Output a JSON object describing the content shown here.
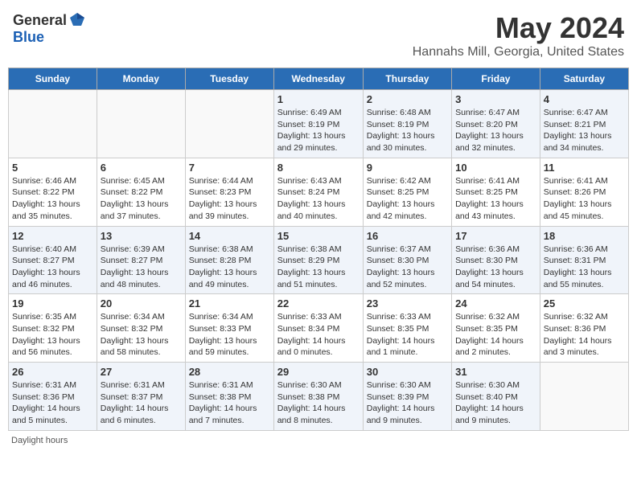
{
  "header": {
    "logo_general": "General",
    "logo_blue": "Blue",
    "month_title": "May 2024",
    "location": "Hannahs Mill, Georgia, United States"
  },
  "days_of_week": [
    "Sunday",
    "Monday",
    "Tuesday",
    "Wednesday",
    "Thursday",
    "Friday",
    "Saturday"
  ],
  "weeks": [
    [
      {
        "day": "",
        "content": ""
      },
      {
        "day": "",
        "content": ""
      },
      {
        "day": "",
        "content": ""
      },
      {
        "day": "1",
        "content": "Sunrise: 6:49 AM\nSunset: 8:19 PM\nDaylight: 13 hours and 29 minutes."
      },
      {
        "day": "2",
        "content": "Sunrise: 6:48 AM\nSunset: 8:19 PM\nDaylight: 13 hours and 30 minutes."
      },
      {
        "day": "3",
        "content": "Sunrise: 6:47 AM\nSunset: 8:20 PM\nDaylight: 13 hours and 32 minutes."
      },
      {
        "day": "4",
        "content": "Sunrise: 6:47 AM\nSunset: 8:21 PM\nDaylight: 13 hours and 34 minutes."
      }
    ],
    [
      {
        "day": "5",
        "content": "Sunrise: 6:46 AM\nSunset: 8:22 PM\nDaylight: 13 hours and 35 minutes."
      },
      {
        "day": "6",
        "content": "Sunrise: 6:45 AM\nSunset: 8:22 PM\nDaylight: 13 hours and 37 minutes."
      },
      {
        "day": "7",
        "content": "Sunrise: 6:44 AM\nSunset: 8:23 PM\nDaylight: 13 hours and 39 minutes."
      },
      {
        "day": "8",
        "content": "Sunrise: 6:43 AM\nSunset: 8:24 PM\nDaylight: 13 hours and 40 minutes."
      },
      {
        "day": "9",
        "content": "Sunrise: 6:42 AM\nSunset: 8:25 PM\nDaylight: 13 hours and 42 minutes."
      },
      {
        "day": "10",
        "content": "Sunrise: 6:41 AM\nSunset: 8:25 PM\nDaylight: 13 hours and 43 minutes."
      },
      {
        "day": "11",
        "content": "Sunrise: 6:41 AM\nSunset: 8:26 PM\nDaylight: 13 hours and 45 minutes."
      }
    ],
    [
      {
        "day": "12",
        "content": "Sunrise: 6:40 AM\nSunset: 8:27 PM\nDaylight: 13 hours and 46 minutes."
      },
      {
        "day": "13",
        "content": "Sunrise: 6:39 AM\nSunset: 8:27 PM\nDaylight: 13 hours and 48 minutes."
      },
      {
        "day": "14",
        "content": "Sunrise: 6:38 AM\nSunset: 8:28 PM\nDaylight: 13 hours and 49 minutes."
      },
      {
        "day": "15",
        "content": "Sunrise: 6:38 AM\nSunset: 8:29 PM\nDaylight: 13 hours and 51 minutes."
      },
      {
        "day": "16",
        "content": "Sunrise: 6:37 AM\nSunset: 8:30 PM\nDaylight: 13 hours and 52 minutes."
      },
      {
        "day": "17",
        "content": "Sunrise: 6:36 AM\nSunset: 8:30 PM\nDaylight: 13 hours and 54 minutes."
      },
      {
        "day": "18",
        "content": "Sunrise: 6:36 AM\nSunset: 8:31 PM\nDaylight: 13 hours and 55 minutes."
      }
    ],
    [
      {
        "day": "19",
        "content": "Sunrise: 6:35 AM\nSunset: 8:32 PM\nDaylight: 13 hours and 56 minutes."
      },
      {
        "day": "20",
        "content": "Sunrise: 6:34 AM\nSunset: 8:32 PM\nDaylight: 13 hours and 58 minutes."
      },
      {
        "day": "21",
        "content": "Sunrise: 6:34 AM\nSunset: 8:33 PM\nDaylight: 13 hours and 59 minutes."
      },
      {
        "day": "22",
        "content": "Sunrise: 6:33 AM\nSunset: 8:34 PM\nDaylight: 14 hours and 0 minutes."
      },
      {
        "day": "23",
        "content": "Sunrise: 6:33 AM\nSunset: 8:35 PM\nDaylight: 14 hours and 1 minute."
      },
      {
        "day": "24",
        "content": "Sunrise: 6:32 AM\nSunset: 8:35 PM\nDaylight: 14 hours and 2 minutes."
      },
      {
        "day": "25",
        "content": "Sunrise: 6:32 AM\nSunset: 8:36 PM\nDaylight: 14 hours and 3 minutes."
      }
    ],
    [
      {
        "day": "26",
        "content": "Sunrise: 6:31 AM\nSunset: 8:36 PM\nDaylight: 14 hours and 5 minutes."
      },
      {
        "day": "27",
        "content": "Sunrise: 6:31 AM\nSunset: 8:37 PM\nDaylight: 14 hours and 6 minutes."
      },
      {
        "day": "28",
        "content": "Sunrise: 6:31 AM\nSunset: 8:38 PM\nDaylight: 14 hours and 7 minutes."
      },
      {
        "day": "29",
        "content": "Sunrise: 6:30 AM\nSunset: 8:38 PM\nDaylight: 14 hours and 8 minutes."
      },
      {
        "day": "30",
        "content": "Sunrise: 6:30 AM\nSunset: 8:39 PM\nDaylight: 14 hours and 9 minutes."
      },
      {
        "day": "31",
        "content": "Sunrise: 6:30 AM\nSunset: 8:40 PM\nDaylight: 14 hours and 9 minutes."
      },
      {
        "day": "",
        "content": ""
      }
    ]
  ],
  "footer": {
    "note": "Daylight hours"
  }
}
